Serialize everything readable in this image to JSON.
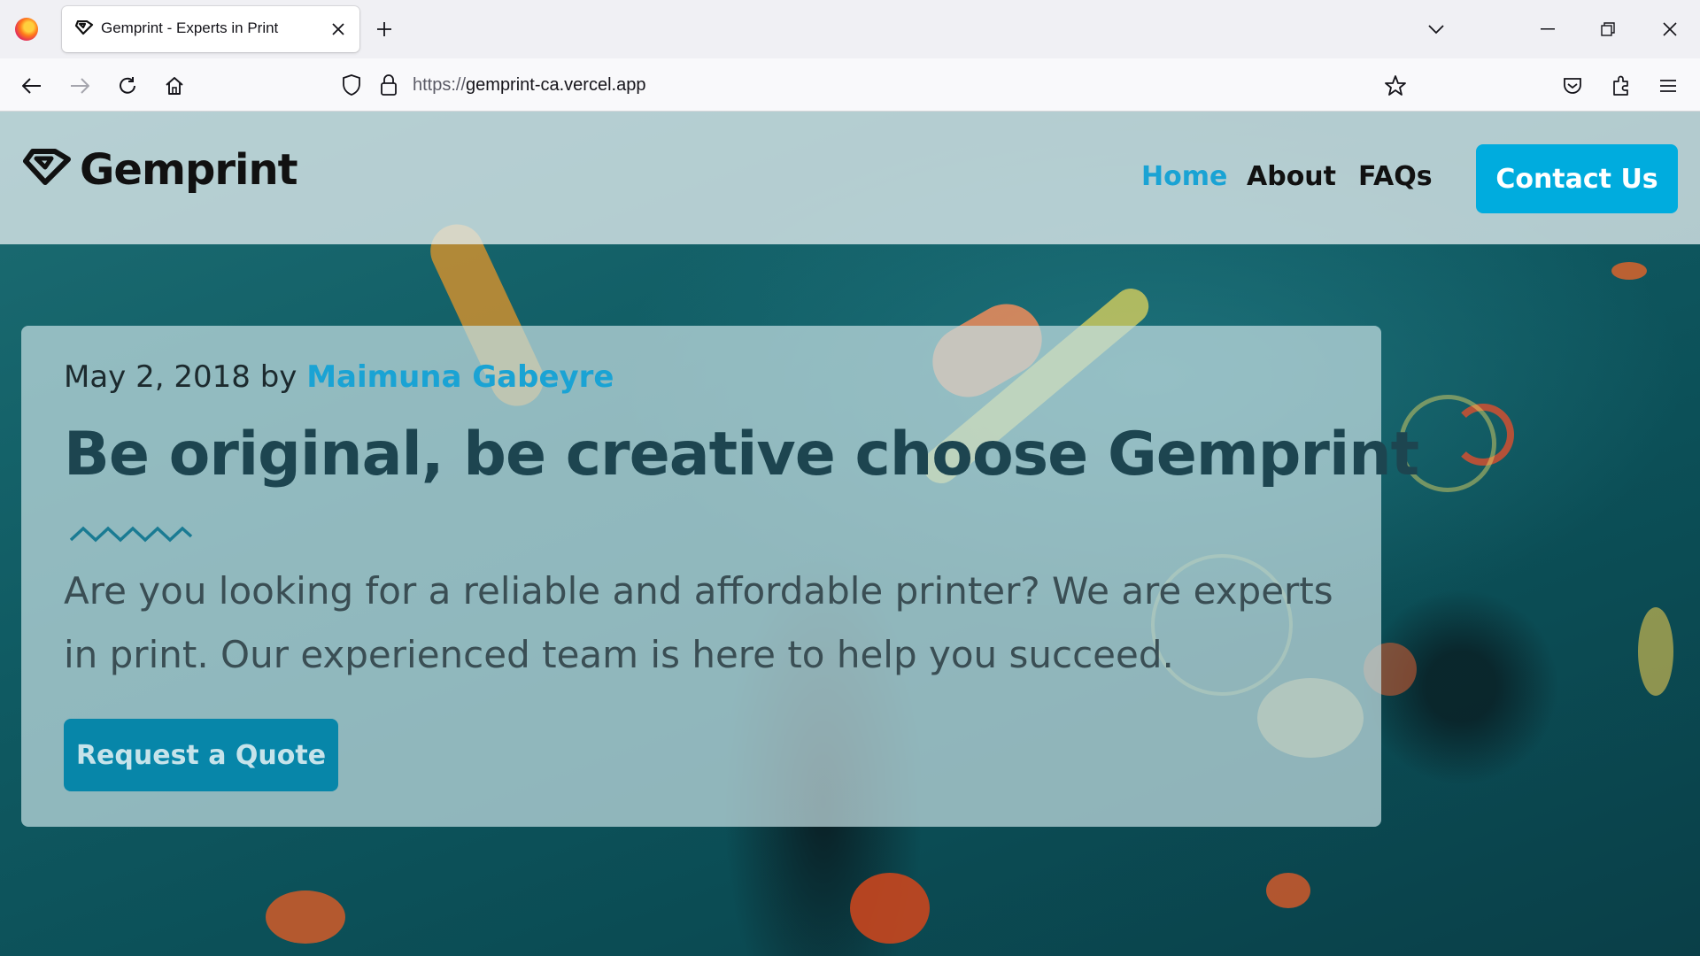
{
  "browser": {
    "tab_title": "Gemprint - Experts in Print",
    "url_scheme": "https://",
    "url_host": "gemprint-ca.vercel.app"
  },
  "site": {
    "brand": "Gemprint",
    "nav": [
      {
        "label": "Home",
        "active": true
      },
      {
        "label": "About",
        "active": false
      },
      {
        "label": "FAQs",
        "active": false
      }
    ],
    "contact_label": "Contact Us"
  },
  "hero": {
    "date": "May 2, 2018",
    "by": "by",
    "author": "Maimuna Gabeyre",
    "headline": "Be original, be creative choose Gemprint",
    "lead": "Are you looking for a reliable and affordable printer? We are experts in print. Our experienced team is here to help you succeed.",
    "cta_label": "Request a Quote"
  },
  "colors": {
    "accent": "#00acde",
    "cta": "#0786a9",
    "headline": "#1d4550"
  }
}
